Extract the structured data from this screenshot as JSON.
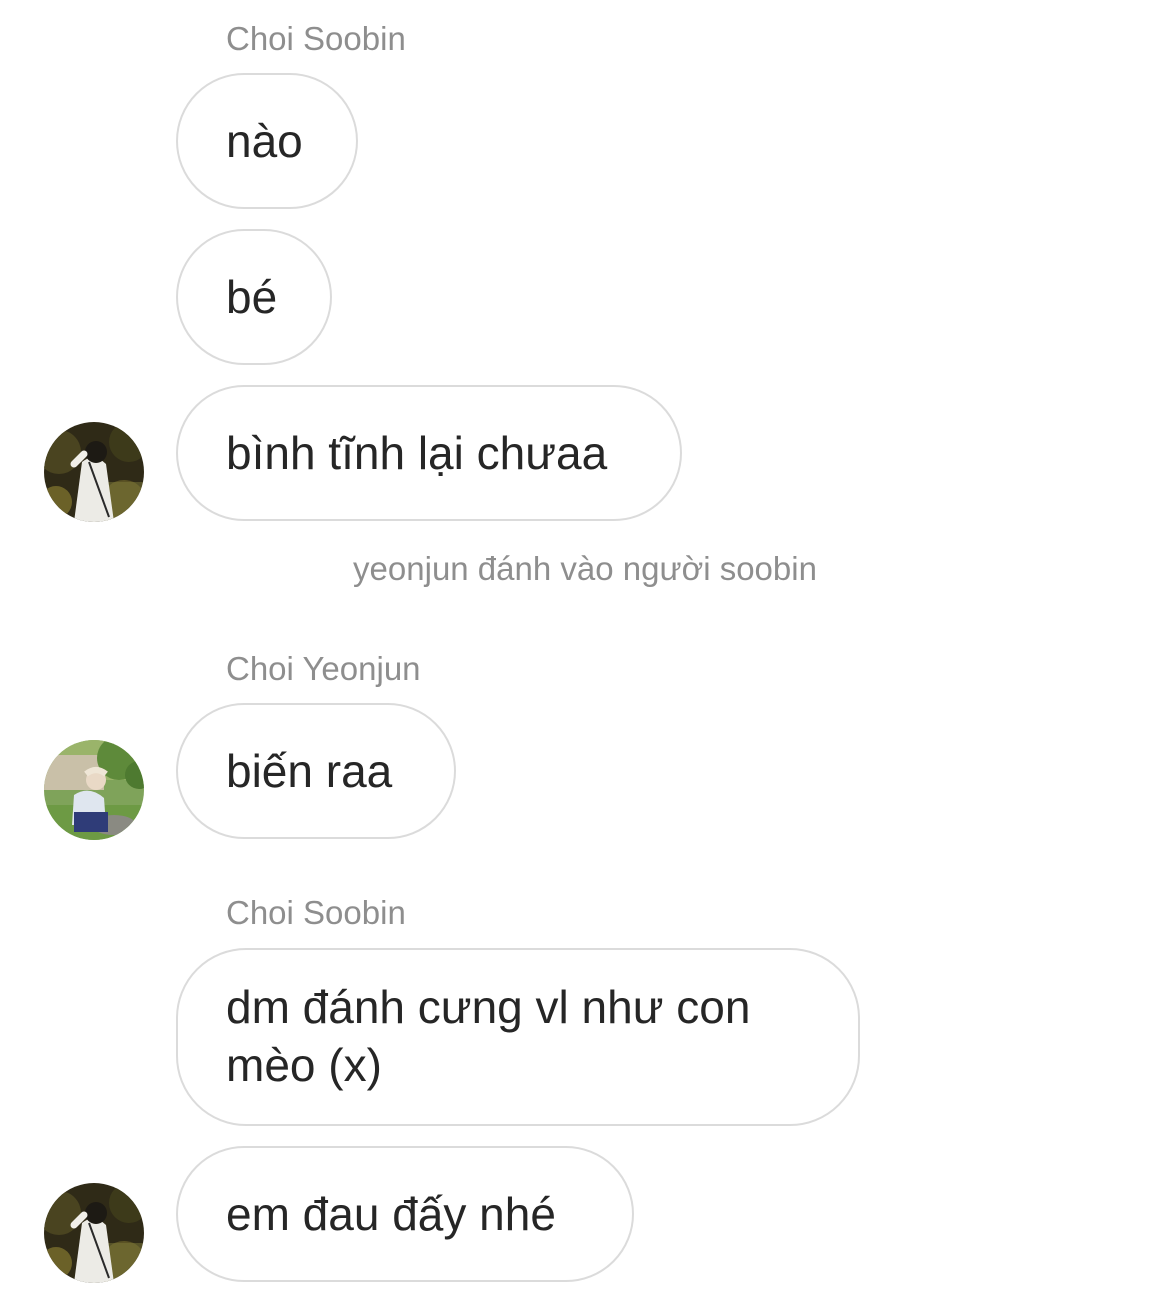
{
  "thread": {
    "group1": {
      "sender": "Choi Soobin",
      "messages": [
        "nào",
        "bé",
        "bình tĩnh lại chưaa"
      ]
    },
    "event": "yeonjun đánh vào người soobin",
    "group2": {
      "sender": "Choi Yeonjun",
      "messages": [
        "biến raa"
      ]
    },
    "group3": {
      "sender": "Choi Soobin",
      "messages": [
        "dm đánh cưng vl như con mèo (x)",
        "em đau đấy nhé"
      ]
    }
  },
  "avatars": {
    "soobin": "avatar-soobin-photo",
    "yeonjun": "avatar-yeonjun-photo"
  },
  "colors": {
    "bubble_border": "#dbdbdb",
    "meta_text": "#8e8e8e",
    "message_text": "#262626"
  }
}
